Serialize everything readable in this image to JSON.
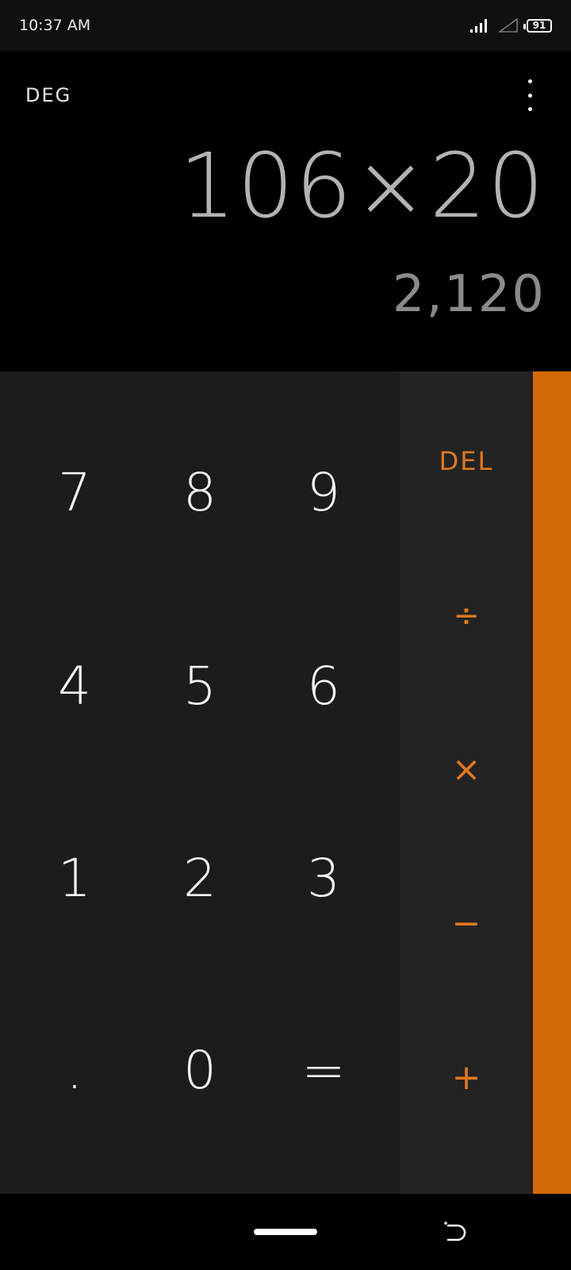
{
  "status_bar": {
    "time": "10:37 AM",
    "battery": "91",
    "icons": [
      "signal-icon",
      "no-signal-icon",
      "battery-icon"
    ]
  },
  "display": {
    "mode": "DEG",
    "expression": "106×20",
    "result": "2,120"
  },
  "keypad": {
    "k7": "7",
    "k8": "8",
    "k9": "9",
    "k4": "4",
    "k5": "5",
    "k6": "6",
    "k1": "1",
    "k2": "2",
    "k3": "3",
    "dot": ".",
    "k0": "0",
    "equals": "="
  },
  "operators": {
    "del": "DEL",
    "divide": "÷",
    "multiply": "×",
    "subtract": "−",
    "add": "+"
  },
  "colors": {
    "accent": "#e0781f",
    "drawer": "#d26a06",
    "keypad_bg": "#1c1c1c",
    "operator_bg": "#232323"
  }
}
